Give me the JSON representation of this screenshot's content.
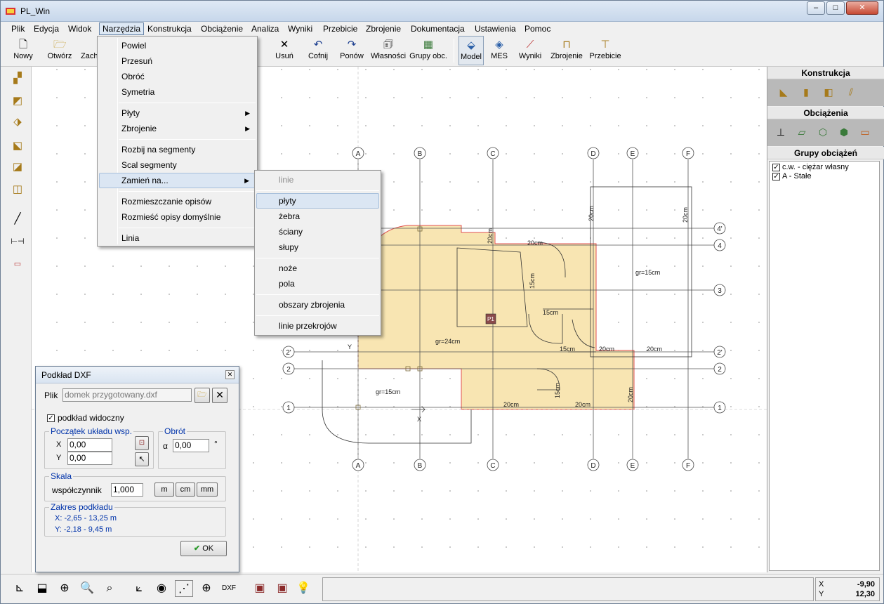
{
  "window": {
    "title": "PL_Win"
  },
  "menubar": [
    "Plik",
    "Edycja",
    "Widok",
    "Narzędzia",
    "Konstrukcja",
    "Obciążenie",
    "Analiza",
    "Wyniki",
    "Przebicie",
    "Zbrojenie",
    "Dokumentacja",
    "Ustawienia",
    "Pomoc"
  ],
  "toolbar": {
    "nowy": "Nowy",
    "otworz": "Otwórz",
    "zach": "Zach",
    "usun": "Usuń",
    "cofnij": "Cofnij",
    "ponow": "Ponów",
    "wlasnosci": "Własności",
    "grupy": "Grupy obc.",
    "model": "Model",
    "mes": "MES",
    "wyniki": "Wyniki",
    "zbrojenie": "Zbrojenie",
    "przebicie": "Przebicie"
  },
  "narzedzia_menu": {
    "items": [
      "Powiel",
      "Przesuń",
      "Obróć",
      "Symetria",
      "Płyty",
      "Zbrojenie",
      "Rozbij na segmenty",
      "Scal segmenty",
      "Zamień na...",
      "Rozmieszczanie opisów",
      "Rozmieść opisy domyślnie",
      "Linia"
    ]
  },
  "submenu": {
    "items": [
      "linie",
      "płyty",
      "żebra",
      "ściany",
      "słupy",
      "noże",
      "pola",
      "obszary zbrojenia",
      "linie przekrojów"
    ]
  },
  "right_panel": {
    "konstrukcja": "Konstrukcja",
    "obciazenia": "Obciążenia",
    "grupy_title": "Grupy obciążeń",
    "groups": [
      "c.w. - ciężar własny",
      "A - Stałe"
    ]
  },
  "drawing": {
    "axes_top": [
      "A",
      "B",
      "C",
      "D",
      "E",
      "F"
    ],
    "axes_right": [
      "4'",
      "4",
      "3",
      "2'",
      "2",
      "1"
    ],
    "axes_left": [
      "2'",
      "2",
      "1"
    ],
    "labels": {
      "gr24": "gr=24cm",
      "gr15a": "gr=15cm",
      "gr15b": "gr=15cm",
      "w20a": "20cm",
      "w20b": "20cm",
      "w20c": "20cm",
      "w20d": "20cm",
      "w20e": "20cm",
      "w20f": "20cm",
      "w20g": "20cm",
      "w20h": "20cm",
      "w20i": "20cm",
      "w15a": "15cm",
      "w15b": "15cm",
      "w15c": "15cm",
      "w15d": "15cm",
      "p1": "P1",
      "x": "X",
      "y": "Y"
    }
  },
  "dialog": {
    "title": "Podkład DXF",
    "plik_label": "Plik",
    "plik_value": "domek przygotowany.dxf",
    "widoczny": "podkład widoczny",
    "poczatek": "Początek układu wsp.",
    "x_label": "X",
    "x_value": "0,00",
    "y_label": "Y",
    "y_value": "0,00",
    "obrot": "Obrót",
    "alpha": "α",
    "obrot_value": "0,00",
    "deg": "°",
    "skala": "Skala",
    "wspolczynnik": "współczynnik",
    "wsp_value": "1,000",
    "m": "m",
    "cm": "cm",
    "mm": "mm",
    "zakres": "Zakres podkładu",
    "zakres_x": "X:  -2,65 - 13,25 m",
    "zakres_y": "Y:  -2,18 - 9,45 m",
    "ok": "OK"
  },
  "status": {
    "x_label": "X",
    "x_value": "-9,90",
    "y_label": "Y",
    "y_value": "12,30"
  }
}
